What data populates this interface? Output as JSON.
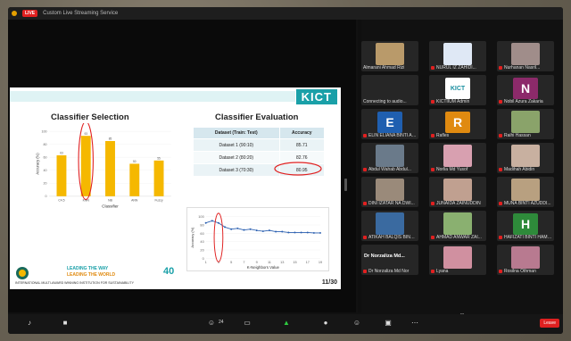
{
  "topbar": {
    "live_label": "LIVE",
    "title": "Custom Live Streaming Service"
  },
  "slide": {
    "banner": "KICT",
    "left_title": "Classifier Selection",
    "right_title": "Classifier Evaluation",
    "page_number": "11/30",
    "footer_line1": "LEADING THE WAY",
    "footer_line2": "LEADING THE WORLD",
    "footer_bottom": "INTERNATIONAL MULTI-AWARD WINNING INSTITUTION FOR SUSTAINABILITY",
    "badge": "40"
  },
  "chart_data": [
    {
      "type": "bar",
      "title": "Classifier Selection",
      "categories": [
        "C4.5",
        "KNN",
        "NB",
        "ANN",
        "Fuzzy"
      ],
      "values": [
        63,
        93,
        85,
        50,
        55
      ],
      "ylabel": "Accuracy (%)",
      "xlabel": "Classifier",
      "ylim": [
        0,
        100
      ],
      "bar_color": "#f5b800",
      "highlight": "KNN"
    },
    {
      "type": "table",
      "columns": [
        "Dataset (Train: Test)",
        "Accuracy"
      ],
      "rows": [
        [
          "Dataset 1 (90:10)",
          "85.71"
        ],
        [
          "Dataset 2 (80:20)",
          "82.76"
        ],
        [
          "Dataset 3 (70:30)",
          "80.95"
        ]
      ]
    },
    {
      "type": "line",
      "x": [
        1,
        2,
        3,
        4,
        5,
        6,
        7,
        8,
        9,
        10,
        11,
        12,
        13,
        14,
        15,
        16,
        17,
        18,
        19
      ],
      "values": [
        85,
        90,
        85,
        75,
        70,
        72,
        68,
        70,
        67,
        65,
        67,
        64,
        64,
        62,
        62,
        62,
        62,
        61,
        61
      ],
      "xticks": [
        "1",
        "3",
        "5",
        "7",
        "9",
        "11",
        "13",
        "15",
        "17",
        "19"
      ],
      "yticks": [
        "0",
        "20",
        "40",
        "60",
        "80",
        "100"
      ],
      "ylabel": "Accuracy (%)",
      "xlabel": "K-Neighbors Value",
      "ylim": [
        0,
        100
      ],
      "color": "#2a5fb0"
    }
  ],
  "participants": [
    {
      "name": "Almarani Ahmad Rizi",
      "kind": "photo",
      "color": "#b99a6a",
      "muted": false
    },
    {
      "name": "NURUL IZ ZAHIDI...",
      "kind": "photo",
      "color": "#dfe8f5",
      "muted": true
    },
    {
      "name": "Nurhanan Nasril...",
      "kind": "photo",
      "color": "#a08d8a",
      "muted": true
    },
    {
      "name": "Connecting to audio...",
      "kind": "empty",
      "color": "#262626",
      "muted": false
    },
    {
      "name": "KICTIIUM Admin",
      "kind": "logo",
      "color": "#1a8fa0",
      "muted": true
    },
    {
      "name": "Nobil Azura Zakaria",
      "kind": "letter",
      "letter": "N",
      "color": "#8c2a6a",
      "muted": true
    },
    {
      "name": "ELIN ELIANA BINTI AB...",
      "kind": "letter",
      "letter": "E",
      "color": "#1f5fb0",
      "muted": true
    },
    {
      "name": "Rafles",
      "kind": "letter",
      "letter": "R",
      "color": "#e08a10",
      "muted": true
    },
    {
      "name": "Raihi Hassan",
      "kind": "photo",
      "color": "#8aa36a",
      "muted": true
    },
    {
      "name": "Abdul Wahab Abdul...",
      "kind": "photo",
      "color": "#6a7a8a",
      "muted": true
    },
    {
      "name": "Norlia Md Yusof",
      "kind": "photo",
      "color": "#d8a0b0",
      "muted": true
    },
    {
      "name": "Madihah Abidin",
      "kind": "photo",
      "color": "#c8b0a0",
      "muted": true
    },
    {
      "name": "DINI IZATAR NA DWI...",
      "kind": "photo",
      "color": "#9a8a7a",
      "muted": true
    },
    {
      "name": "JUNAIDA ZAINUDDIN",
      "kind": "photo",
      "color": "#c0a090",
      "muted": true
    },
    {
      "name": "MUNA BINTI AZUDDI...",
      "kind": "photo",
      "color": "#b8a080",
      "muted": true
    },
    {
      "name": "ATIKAH BALQIS BINTI...",
      "kind": "photo",
      "color": "#3a6aa0",
      "muted": true
    },
    {
      "name": "AHMAD ANWAR ZAI...",
      "kind": "photo",
      "color": "#8ab070",
      "muted": true
    },
    {
      "name": "HAFIZATI BINTI HAMIDI",
      "kind": "letter",
      "letter": "H",
      "color": "#2e8a3a",
      "muted": true
    },
    {
      "name": "Dr Norzaliza Md Nor",
      "kind": "text",
      "color": "#262626",
      "label": "Dr Norzaliza Md...",
      "muted": true
    },
    {
      "name": "Lyana",
      "kind": "photo",
      "color": "#d090a0",
      "muted": true
    },
    {
      "name": "Rosilna Othman",
      "kind": "photo",
      "color": "#b87a90",
      "muted": true
    }
  ],
  "toolbar": {
    "participants_count": "24",
    "leave_label": "Leave"
  }
}
